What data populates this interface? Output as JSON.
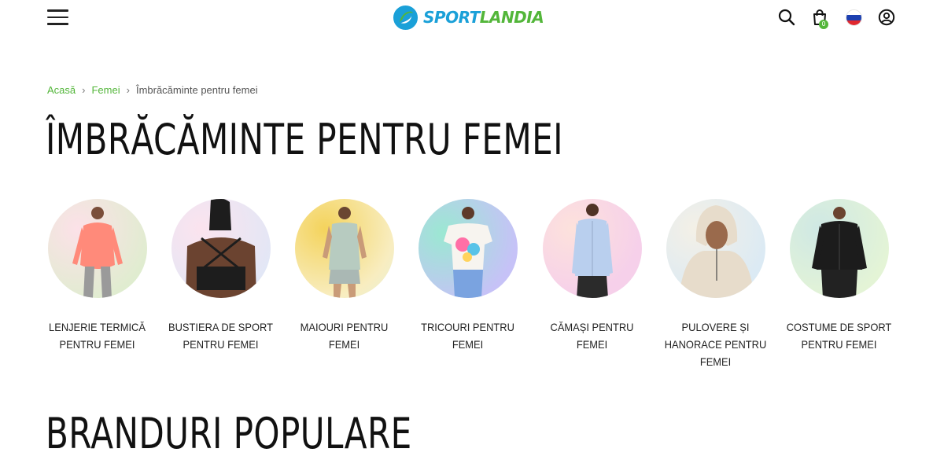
{
  "header": {
    "logo": {
      "part1": "SPORT",
      "part2": "LANDIA"
    },
    "cart_count": "0",
    "menu_icon": "hamburger-menu-icon",
    "search_icon": "search-icon",
    "cart_icon": "shopping-bag-icon",
    "language_icon": "russian-flag-icon",
    "account_icon": "user-account-icon"
  },
  "breadcrumb": {
    "items": [
      "Acasă",
      "Femei"
    ],
    "current": "Îmbrăcăminte pentru femei"
  },
  "page_title": "ÎMBRĂCĂMINTE PENTRU FEMEI",
  "categories": [
    {
      "label": "LENJERIE TERMICĂ PENTRU FEMEI"
    },
    {
      "label": "BUSTIERA DE SPORT PENTRU FEMEI"
    },
    {
      "label": "MAIOURI PENTRU FEMEI"
    },
    {
      "label": "TRICOURI PENTRU FEMEI"
    },
    {
      "label": "CĂMAȘI PENTRU FEMEI"
    },
    {
      "label": "PULOVERE ȘI HANORACE PENTRU FEMEI"
    },
    {
      "label": "COSTUME DE SPORT PENTRU FEMEI"
    }
  ],
  "brands_title": "BRANDURI POPULARE",
  "colors": {
    "accent_green": "#53b63a",
    "logo_blue": "#1aa0d8"
  }
}
